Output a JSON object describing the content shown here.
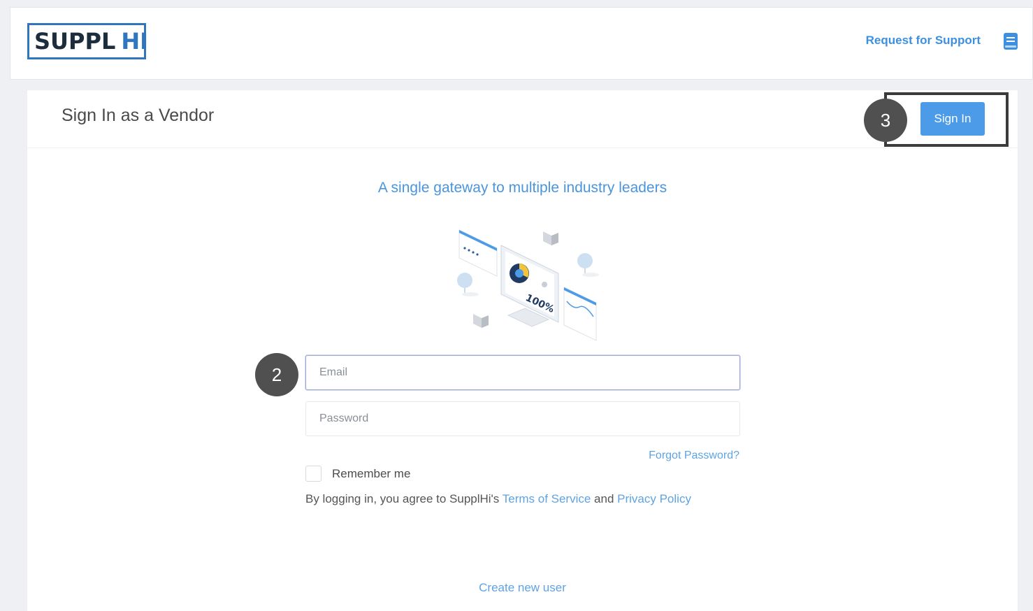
{
  "header": {
    "logo_left": "SUPPL",
    "logo_right": "HI",
    "support_link": "Request for Support",
    "book_icon": "book-icon"
  },
  "card": {
    "title": "Sign In as a Vendor",
    "signin_button": "Sign In",
    "badge_signin": "3",
    "badge_email": "2",
    "tagline": "A single gateway to multiple industry leaders",
    "illustration_text": "100%"
  },
  "form": {
    "email_placeholder": "Email",
    "email_value": "",
    "password_placeholder": "Password",
    "password_value": "",
    "forgot_password": "Forgot Password?",
    "remember_me": "Remember me",
    "remember_checked": false,
    "agree_prefix": "By logging in, you agree to SupplHi's ",
    "terms_link": "Terms of Service",
    "agree_and": " and ",
    "privacy_link": "Privacy Policy",
    "create_user": "Create new user"
  },
  "colors": {
    "accent": "#4c9be9",
    "link": "#5fa3e3",
    "logo_blue": "#2f76bf",
    "badge": "#505050"
  }
}
